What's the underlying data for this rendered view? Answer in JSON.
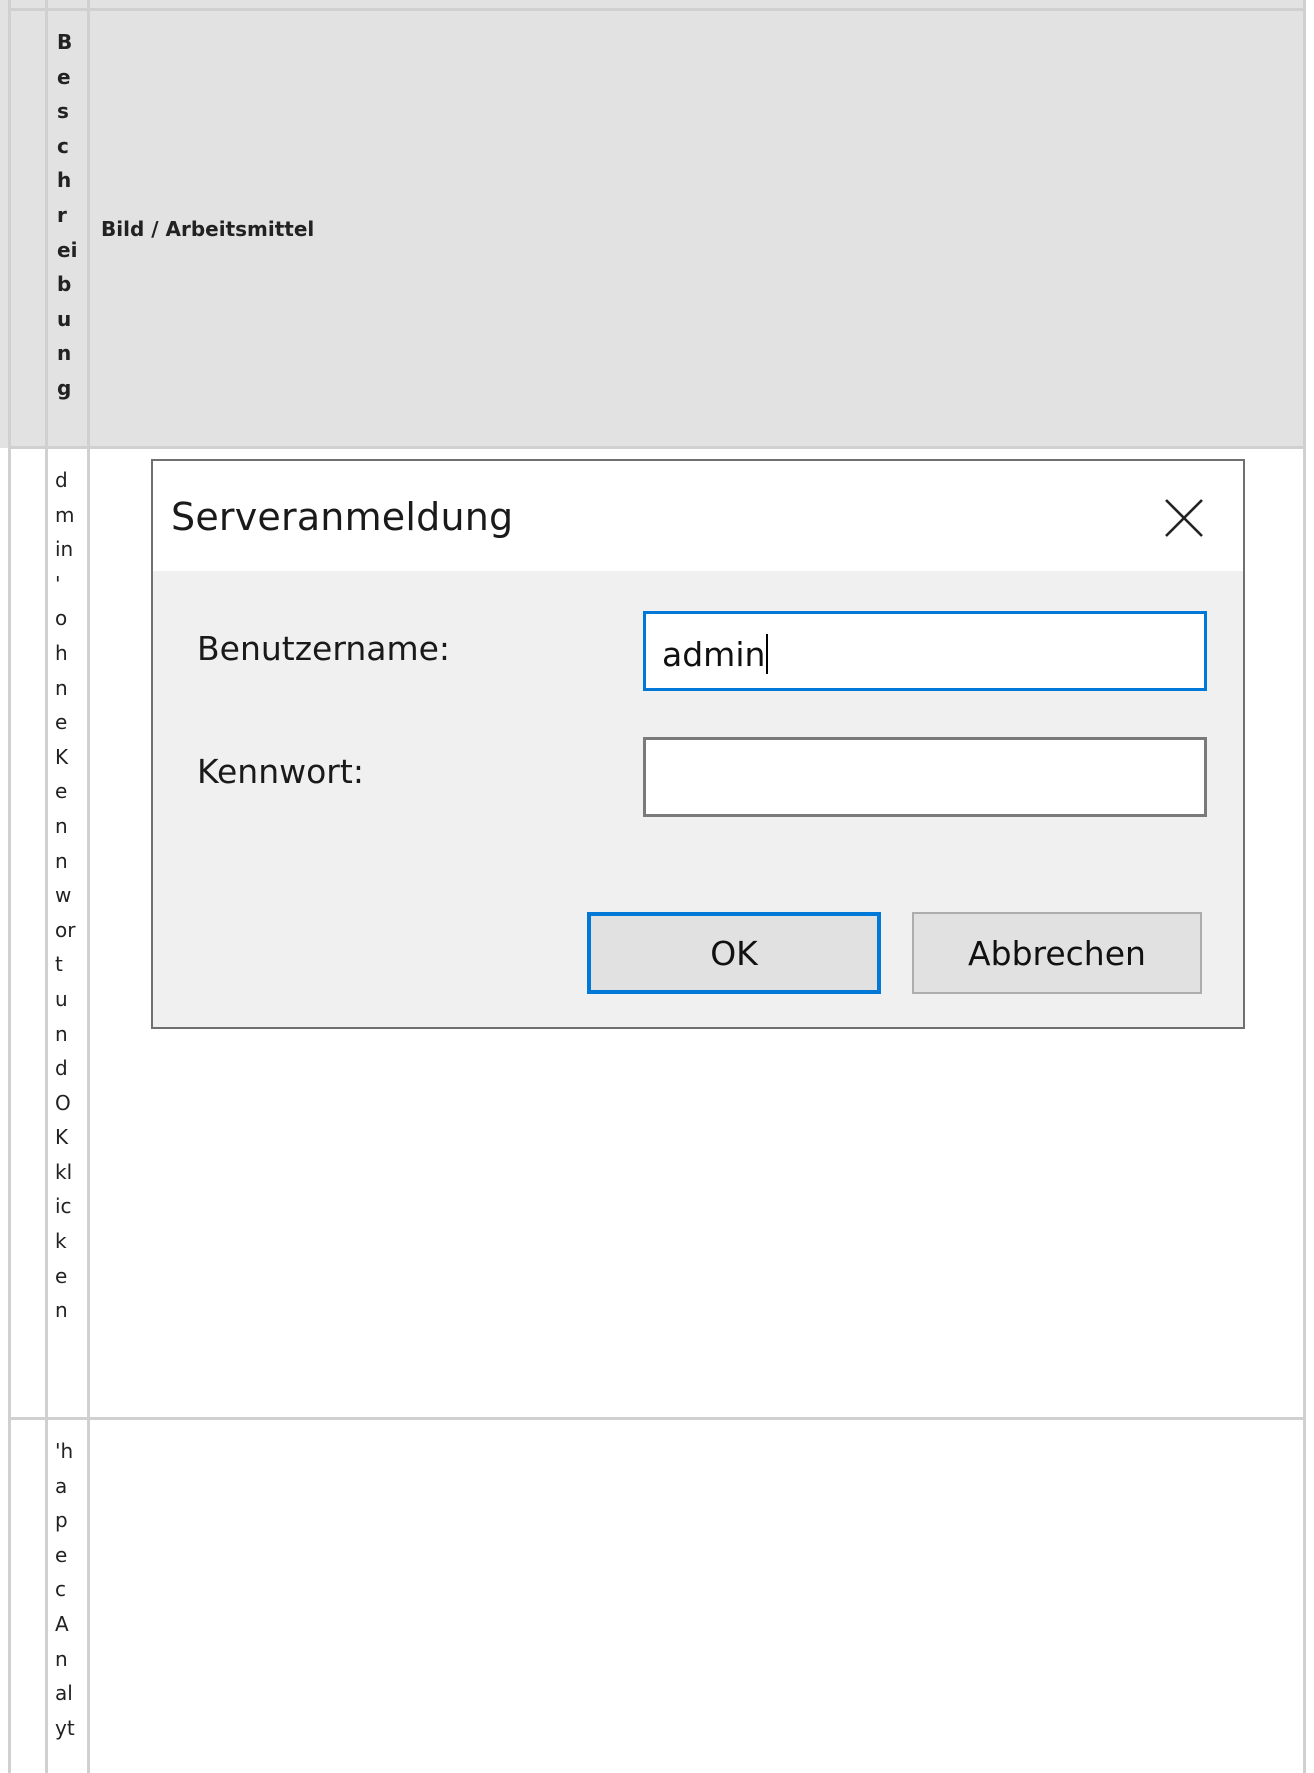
{
  "header": {
    "col1_label_chars": [
      "B",
      "e",
      "s",
      "c",
      "h",
      "r",
      "ei",
      "b",
      "u",
      "n",
      "g"
    ],
    "col2_label": "Bild / Arbeitsmittel"
  },
  "rows": [
    {
      "description_chars": [
        "d",
        "m",
        "in",
        "'",
        "o",
        "h",
        "n",
        "e",
        "K",
        "e",
        "n",
        "n",
        "w",
        "or",
        "t",
        "u",
        "n",
        "d",
        "O",
        "K",
        "kl",
        "ic",
        "k",
        "e",
        "n"
      ]
    },
    {
      "description_chars": [
        "'h",
        "a",
        "p",
        "e",
        "c",
        "A",
        "n",
        "al",
        "yt"
      ]
    }
  ],
  "dialog": {
    "title": "Serveranmeldung",
    "close_icon": "close-icon",
    "username_label": "Benutzername:",
    "username_value": "admin",
    "password_label": "Kennwort:",
    "password_value": "",
    "ok_label": "OK",
    "cancel_label": "Abbrechen",
    "accent_color": "#0078d7"
  }
}
